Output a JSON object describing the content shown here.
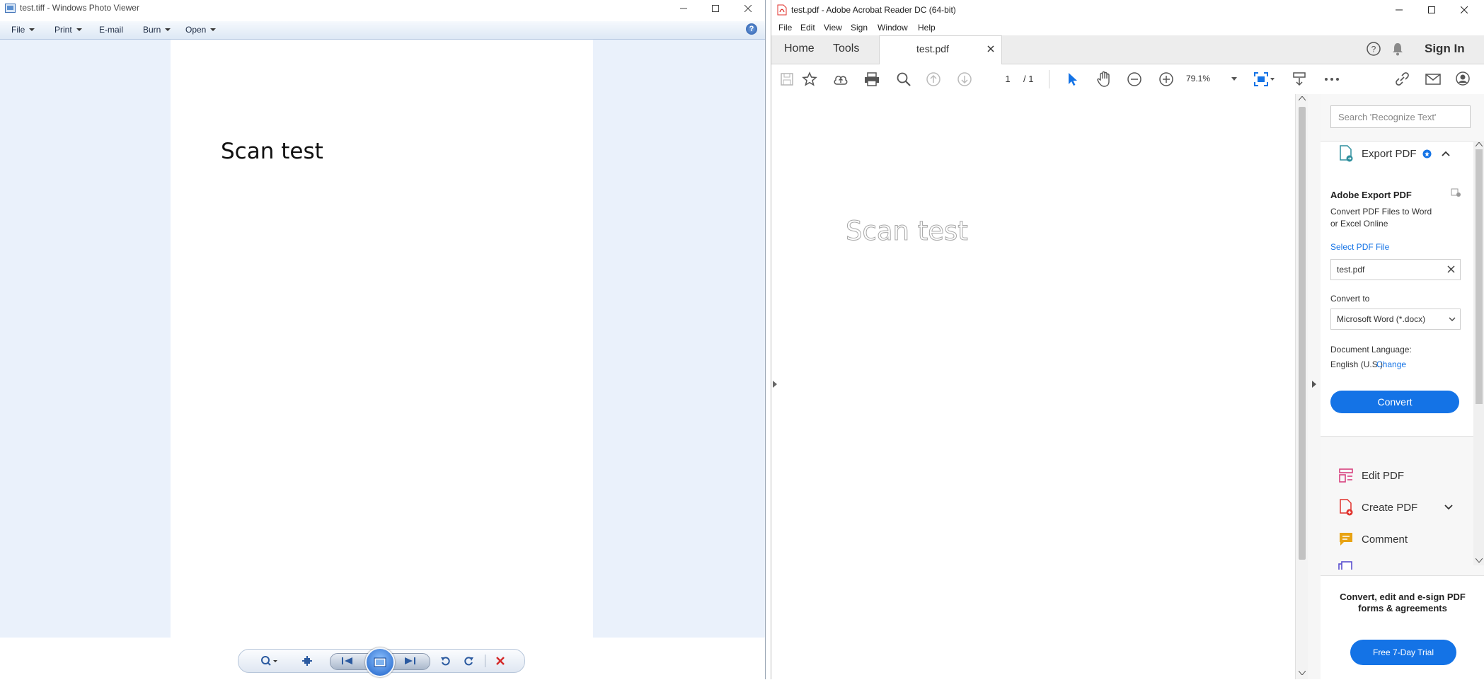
{
  "photo_viewer": {
    "window_title": "test.tiff - Windows Photo Viewer",
    "menu": [
      "File",
      "Print",
      "E-mail",
      "Burn",
      "Open"
    ],
    "help_label": "?",
    "image_text": "Scan test"
  },
  "acrobat": {
    "window_title": "test.pdf - Adobe Acrobat Reader DC (64-bit)",
    "menu": [
      "File",
      "Edit",
      "View",
      "Sign",
      "Window",
      "Help"
    ],
    "tabs": {
      "home": "Home",
      "tools": "Tools",
      "document": "test.pdf"
    },
    "sign_in": "Sign In",
    "page_current": "1",
    "page_total": "/ 1",
    "zoom": "79.1%",
    "document_text": "Scan test",
    "search_placeholder": "Search 'Recognize Text'",
    "export": {
      "header": "Export PDF",
      "title": "Adobe Export PDF",
      "description_line1": "Convert PDF Files to Word",
      "description_line2": "or Excel Online",
      "select_link": "Select PDF File",
      "file_name": "test.pdf",
      "convert_to_label": "Convert to",
      "convert_to_value": "Microsoft Word (*.docx)",
      "doc_language_label": "Document Language:",
      "doc_language_value": "English (U.S.)",
      "change_link": "Change",
      "convert_button": "Convert"
    },
    "tools": [
      "Edit PDF",
      "Create PDF",
      "Comment"
    ],
    "promo_line1": "Convert, edit and e-sign PDF",
    "promo_line2": "forms & agreements",
    "trial_button": "Free 7-Day Trial"
  },
  "colors": {
    "acrobat_blue": "#1473e6",
    "viewer_bg": "#eaf1fb",
    "acrobat_red": "#e0312b"
  }
}
